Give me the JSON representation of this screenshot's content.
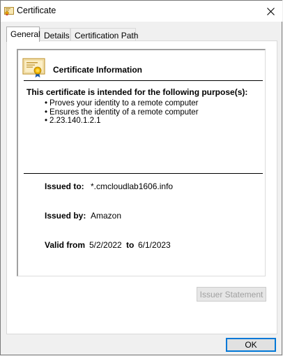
{
  "window": {
    "title": "Certificate",
    "close_icon": "close-icon",
    "title_icon": "certificate-icon"
  },
  "tabs": [
    {
      "label": "General",
      "active": true
    },
    {
      "label": "Details",
      "active": false
    },
    {
      "label": "Certification Path",
      "active": false
    }
  ],
  "general": {
    "info_title": "Certificate Information",
    "purpose_heading": "This certificate is intended for the following purpose(s):",
    "purposes": [
      "Proves your identity to a remote computer",
      "Ensures the identity of a remote computer",
      "2.23.140.1.2.1"
    ],
    "issued_to_label": "Issued to:",
    "issued_to_value": "*.cmcloudlab1606.info",
    "issued_by_label": "Issued by:",
    "issued_by_value": "Amazon",
    "valid_from_label": "Valid from",
    "valid_from_value": "5/2/2022",
    "valid_to_label": "to",
    "valid_to_value": "6/1/2023",
    "issuer_statement_label": "Issuer Statement",
    "issuer_statement_enabled": false
  },
  "footer": {
    "ok_label": "OK"
  },
  "colors": {
    "focus_border": "#0078d7",
    "disabled_text": "#a0a0a0"
  }
}
